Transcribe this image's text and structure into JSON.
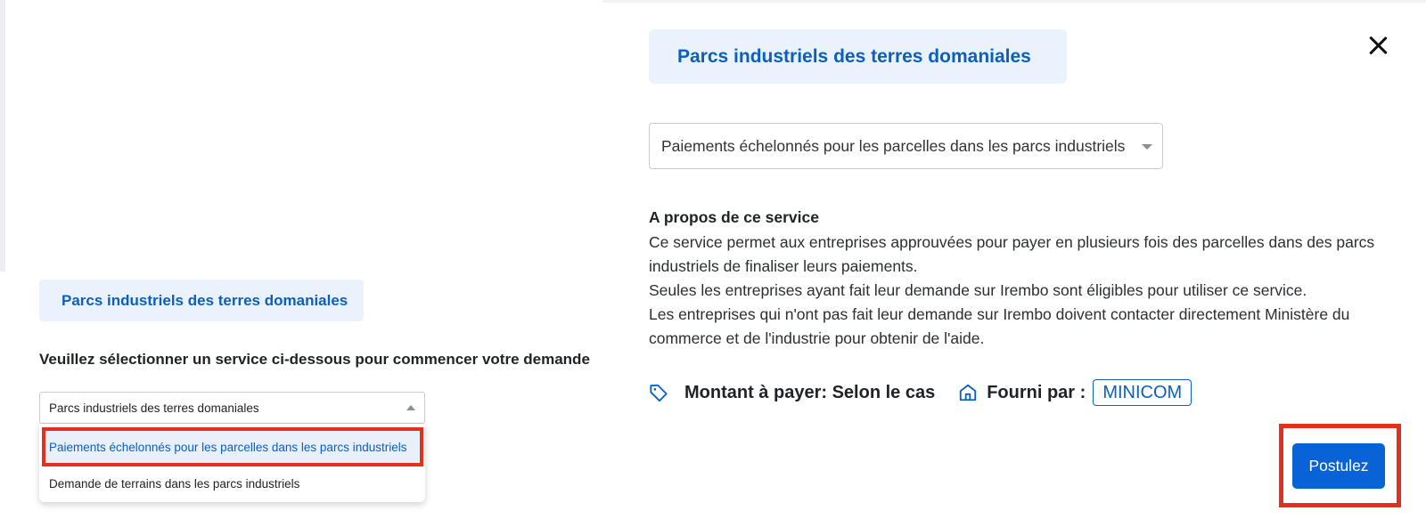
{
  "left": {
    "category_tag": "Parcs industriels des terres domaniales",
    "prompt": "Veuillez sélectionner un service ci-dessous pour commencer votre demande",
    "select_value": "Parcs industriels des terres domaniales",
    "dropdown_options": [
      "Paiements échelonnés pour les parcelles dans les parcs industriels",
      "Demande de terrains dans les parcs industriels"
    ]
  },
  "right": {
    "category_tag": "Parcs industriels des terres domaniales",
    "service_select_value": "Paiements échelonnés pour les parcelles dans les parcs industriels",
    "about_title": "A propos de ce service",
    "about_paragraphs": [
      "Ce service permet aux entreprises approuvées pour payer en plusieurs fois des parcelles dans des parcs industriels de finaliser leurs paiements.",
      "Seules les entreprises ayant fait leur demande sur Irembo sont éligibles pour utiliser ce service.",
      "Les entreprises qui n'ont pas fait leur demande sur Irembo doivent contacter directement Ministère du commerce et de l'industrie pour obtenir de l'aide."
    ],
    "amount_label": "Montant à payer: Selon le cas",
    "provider_label": "Fourni par :",
    "provider_value": "MINICOM",
    "apply_button": "Postulez"
  },
  "icons": {
    "close": "close-icon",
    "tag": "price-tag-icon",
    "home": "home-icon",
    "dropdown": "chevron-down-icon"
  },
  "colors": {
    "brand_blue": "#0a5fbf",
    "button_blue": "#0a63d6",
    "tag_bg": "#eaf3fd",
    "highlight_red": "#e2301c"
  }
}
